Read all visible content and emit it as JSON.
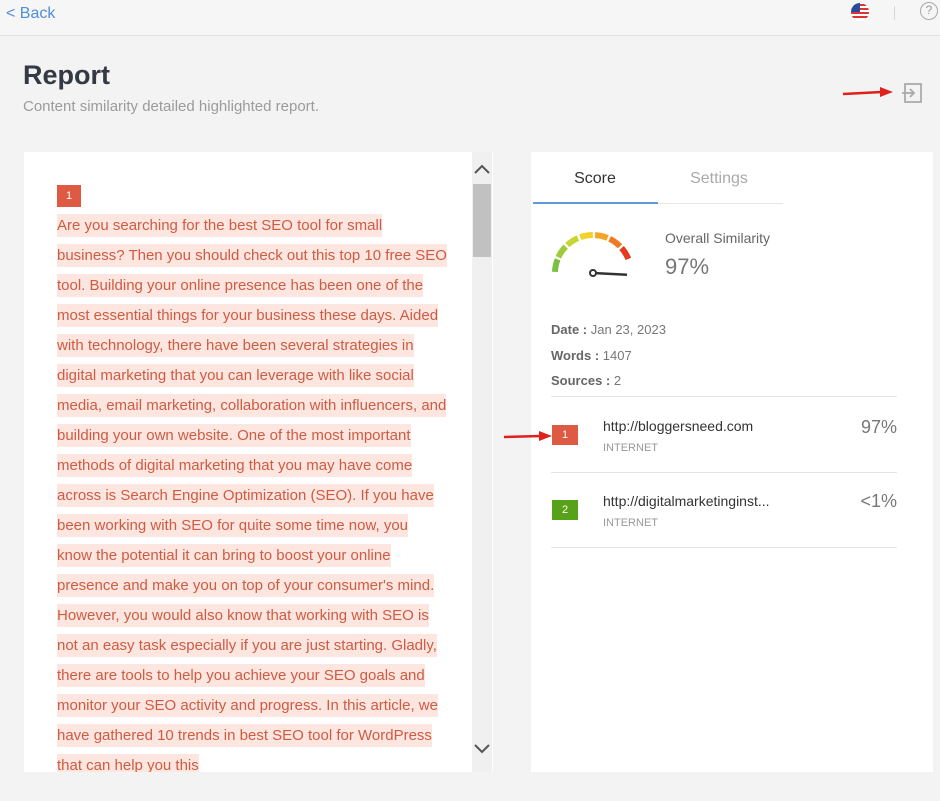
{
  "topbar": {
    "back_label": "< Back",
    "help_label": "?"
  },
  "header": {
    "title": "Report",
    "subtitle": "Content similarity detailed highlighted report."
  },
  "left": {
    "badge": "1",
    "text": "Are you searching for the best SEO tool for small business? Then you should check out this top 10 free SEO tool.   Building your online presence has been one of the most essential things for your business these days. Aided with technology, there have been several strategies in digital marketing that you can leverage with like social media, email marketing, collaboration with influencers, and building your own website.   One of the most important methods of digital marketing that you may have come across is Search Engine Optimization (SEO). If you have been working with SEO for quite some time now, you know the potential it can bring to boost your online presence and make you on top of your consumer's mind.   However, you would also know that working with SEO is not an easy task especially if you are just starting. Gladly, there are tools to help you achieve your SEO goals and monitor your SEO activity and progress.   In this article, we have gathered 10 trends in best SEO tool for WordPress that can help you this"
  },
  "tabs": {
    "score": "Score",
    "settings": "Settings"
  },
  "score": {
    "label": "Overall Similarity",
    "value": "97%",
    "gauge_level": 0.97,
    "date_label": "Date :",
    "date": "Jan 23, 2023",
    "words_label": "Words :",
    "words": "1407",
    "sources_label": "Sources :",
    "sources": "2"
  },
  "sources": [
    {
      "num": "1",
      "url": "http://bloggersneed.com",
      "type": "INTERNET",
      "pct": "97%",
      "color": "#de5a42"
    },
    {
      "num": "2",
      "url": "http://digitalmarketinginst...",
      "type": "INTERNET",
      "pct": "<1%",
      "color": "#58a219"
    }
  ],
  "colors": {
    "accent": "#5d9bdb",
    "highlight_text": "#cf5b43",
    "highlight_bg": "#fce6df",
    "annotation_arrow": "#e0201b"
  }
}
